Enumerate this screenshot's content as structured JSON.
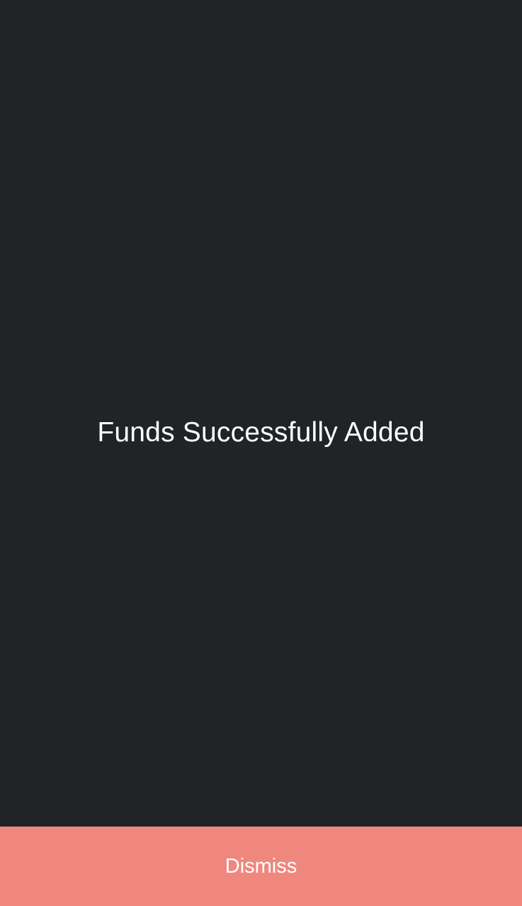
{
  "screen": {
    "message": "Funds Successfully Added"
  },
  "footer": {
    "dismiss_label": "Dismiss"
  },
  "colors": {
    "background": "#202427",
    "accent": "#f0877f",
    "text": "#ffffff"
  }
}
